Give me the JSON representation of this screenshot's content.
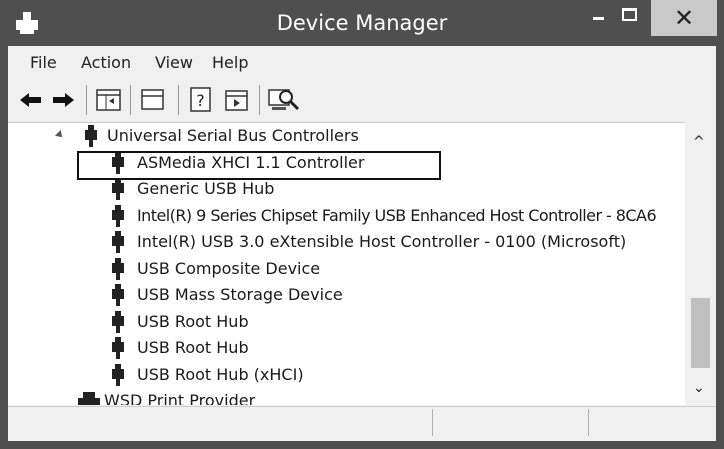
{
  "window": {
    "title": "Device Manager",
    "close_glyph": "✕",
    "colors": {
      "titlebar": "#4f4f4f",
      "close_button": "#c9c9c9"
    }
  },
  "menu": {
    "items": [
      {
        "label": "File"
      },
      {
        "label": "Action"
      },
      {
        "label": "View"
      },
      {
        "label": "Help"
      }
    ]
  },
  "toolbar": {
    "icons": [
      "back-arrow-icon",
      "forward-arrow-icon",
      "properties-icon",
      "window-icon",
      "help-icon",
      "run-icon",
      "scan-hardware-icon"
    ],
    "help_glyph": "?"
  },
  "tree": {
    "category": {
      "label": "Universal Serial Bus Controllers",
      "expanded": true
    },
    "items": [
      {
        "label": "ASMedia XHCI 1.1 Controller",
        "highlighted": true
      },
      {
        "label": "Generic USB Hub"
      },
      {
        "label": "Intel(R) 9 Series Chipset Family USB Enhanced Host Controller - 8CA6"
      },
      {
        "label": "Intel(R) USB 3.0 eXtensible Host Controller - 0100 (Microsoft)"
      },
      {
        "label": "USB Composite Device"
      },
      {
        "label": "USB Mass Storage Device"
      },
      {
        "label": "USB Root Hub"
      },
      {
        "label": "USB Root Hub"
      },
      {
        "label": "USB Root Hub (xHCI)"
      }
    ],
    "next_category": {
      "label": "WSD Print Provider"
    }
  },
  "scrollbar": {
    "up_glyph": "^",
    "down_glyph": "⌄"
  }
}
